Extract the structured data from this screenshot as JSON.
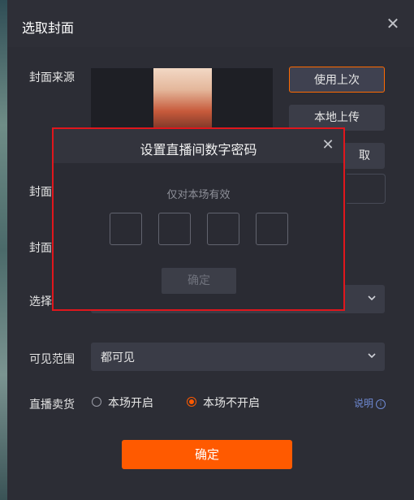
{
  "dialog": {
    "title": "选取封面",
    "close_icon": "close-icon"
  },
  "labels": {
    "cover_source": "封面来源",
    "cover_row2": "封面",
    "cover_row3": "封面",
    "select_row": "选择",
    "visibility": "可见范围",
    "live_sales": "直播卖货"
  },
  "cover_buttons": {
    "use_last": "使用上次",
    "local_upload": "本地上传",
    "third_partial": "取"
  },
  "visibility": {
    "value": "都可见"
  },
  "live_sales": {
    "options": [
      {
        "label": "本场开启",
        "selected": false
      },
      {
        "label": "本场不开启",
        "selected": true
      }
    ],
    "help_label": "说明",
    "help_icon": "info-icon"
  },
  "confirm_label": "确定",
  "colors": {
    "accent": "#ff5a00",
    "highlight_border": "#e0161c",
    "link": "#6f8ad4"
  },
  "password_modal": {
    "title": "设置直播间数字密码",
    "hint": "仅对本场有效",
    "digits": [
      "",
      "",
      "",
      ""
    ],
    "confirm_label": "确定",
    "close_icon": "close-icon"
  }
}
